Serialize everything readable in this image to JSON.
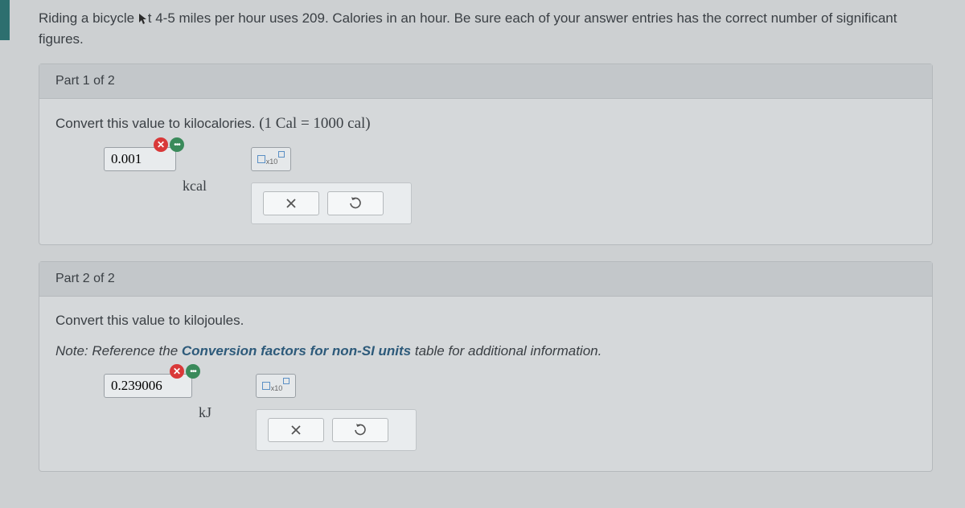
{
  "question": {
    "text_before_cursor": "Riding a bicycle ",
    "text_after_cursor": "t 4-5 miles per hour uses 209. Calories in an hour. Be sure each of your answer entries has the correct number of significant figures."
  },
  "part1": {
    "header": "Part 1 of 2",
    "prompt": "Convert this value to kilocalories. ",
    "formula": "(1 Cal = 1000 cal)",
    "answer_value": "0.001",
    "unit": "kcal",
    "sci_label": "x10"
  },
  "part2": {
    "header": "Part 2 of 2",
    "prompt": "Convert this value to kilojoules.",
    "note_label": "Note:",
    "note_prefix": " Reference the ",
    "note_link": "Conversion factors for non-SI units",
    "note_suffix": " table for additional information.",
    "answer_value": "0.239006",
    "unit": "kJ",
    "sci_label": "x10"
  }
}
